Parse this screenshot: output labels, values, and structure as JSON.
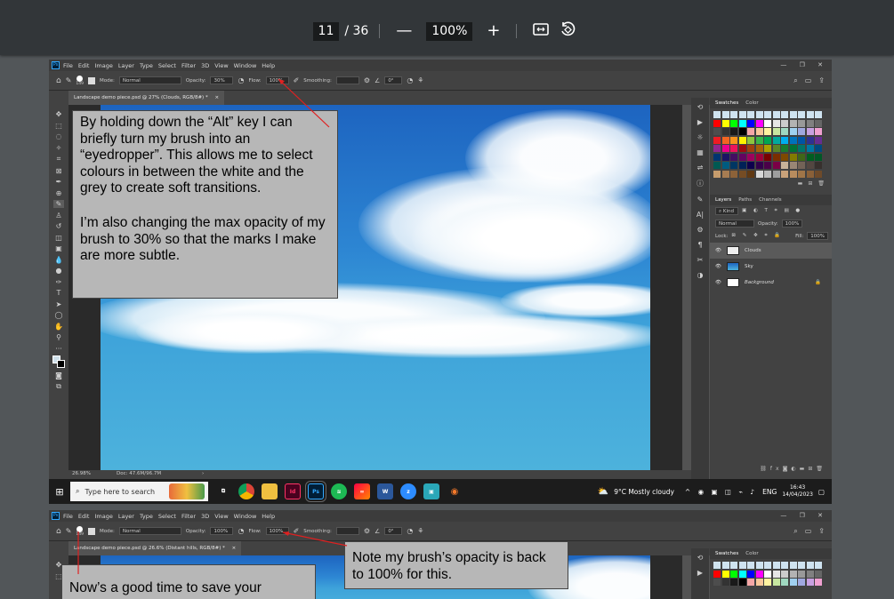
{
  "viewer": {
    "current_page": "11",
    "page_total": "/ 36",
    "zoom_out": "—",
    "zoom": "100%",
    "zoom_in": "+"
  },
  "shot1": {
    "ps_icon": "Ps",
    "menu": [
      "File",
      "Edit",
      "Image",
      "Layer",
      "Type",
      "Select",
      "Filter",
      "3D",
      "View",
      "Window",
      "Help"
    ],
    "options": {
      "mode_label": "Mode:",
      "mode_value": "Normal",
      "brush_size": "149",
      "opacity_label": "Opacity:",
      "opacity_value": "30%",
      "flow_label": "Flow:",
      "flow_value": "100%",
      "smoothing_label": "Smoothing:",
      "angle_value": "0°"
    },
    "doc_tab": "Landscape demo piece.psd @ 27% (Clouds, RGB/8#) *",
    "status_zoom": "26.98%",
    "status_doc": "Doc: 47.6M/96.7M",
    "callout": {
      "para1": "By holding down the “Alt” key I can briefly turn my brush into an “eyedropper”. This allows me to select colours in between the white and the grey to create soft transitions.",
      "para2": "I’m also changing the max opacity of my brush to 30% so that the marks I make are more subtle."
    },
    "panels": {
      "swatch_tabs": [
        "Swatches",
        "Color"
      ],
      "layer_tabs": [
        "Layers",
        "Paths",
        "Channels"
      ],
      "kind_label": "Kind",
      "blend_mode": "Normal",
      "opacity_label": "Opacity:",
      "opacity_value": "100%",
      "lock_label": "Lock:",
      "fill_label": "Fill:",
      "fill_value": "100%",
      "layers": [
        "Clouds",
        "Sky",
        "Background"
      ]
    },
    "taskbar": {
      "search_placeholder": "Type here to search",
      "weather": "9°C  Mostly cloudy",
      "lang": "ENG",
      "time": "16:43",
      "date": "14/04/2023"
    }
  },
  "shot2": {
    "menu": [
      "File",
      "Edit",
      "Image",
      "Layer",
      "Type",
      "Select",
      "Filter",
      "3D",
      "View",
      "Window",
      "Help"
    ],
    "options": {
      "mode_label": "Mode:",
      "mode_value": "Normal",
      "brush_size": "149",
      "opacity_label": "Opacity:",
      "opacity_value": "100%",
      "flow_label": "Flow:",
      "flow_value": "100%",
      "smoothing_label": "Smoothing:",
      "angle_value": "0°"
    },
    "doc_tab": "Landscape demo piece.psd @ 26.6% (Distant hills, RGB/8#) *",
    "swatch_tabs": [
      "Swatches",
      "Color"
    ],
    "callout_left": "Now’s a good time to save your",
    "callout_right": "Note my brush’s opacity is back to 100% for this."
  },
  "colors": {
    "viewer_bg": "#525659",
    "viewer_bar": "#323639",
    "callout_bg": "#b7b7b7",
    "annotation_red": "#e02020"
  }
}
